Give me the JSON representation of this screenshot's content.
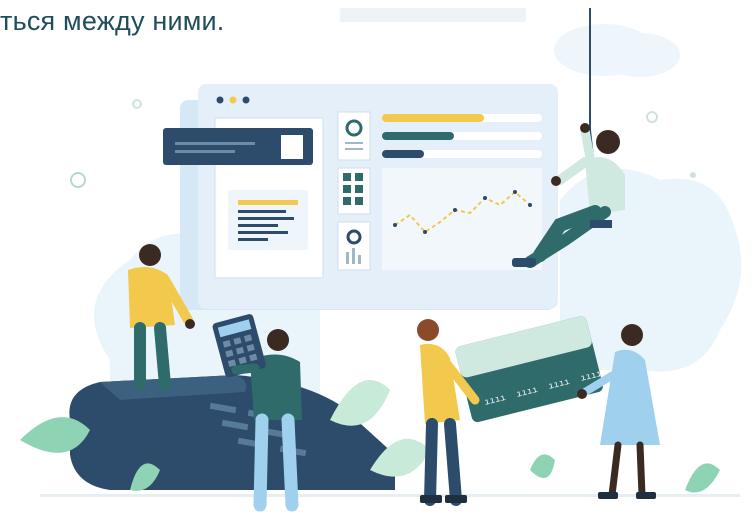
{
  "caption": {
    "text": "ться между ними."
  },
  "illustration": {
    "subject": "people working with a payment terminal, calculator, bank card and analytics dashboard",
    "icons": [
      "payment-terminal-icon",
      "calculator-icon",
      "credit-card-icon",
      "dashboard-window-icon",
      "line-chart-icon",
      "donut-chart-icon",
      "grid-icon"
    ],
    "card_number_groups": [
      "ıııı",
      "ıııı",
      "ıııı",
      "ıııı"
    ],
    "colors": {
      "teal": "#2e6b6a",
      "navy": "#2d4b6b",
      "yellow": "#f2c94c",
      "light_blue": "#dce9f7",
      "sky": "#e9f3fb",
      "skin_dark": "#3b2a22",
      "shirt_mint": "#cfe9e1",
      "dress_blue": "#9fd0ee",
      "leaf_green": "#8fd3b5"
    }
  }
}
